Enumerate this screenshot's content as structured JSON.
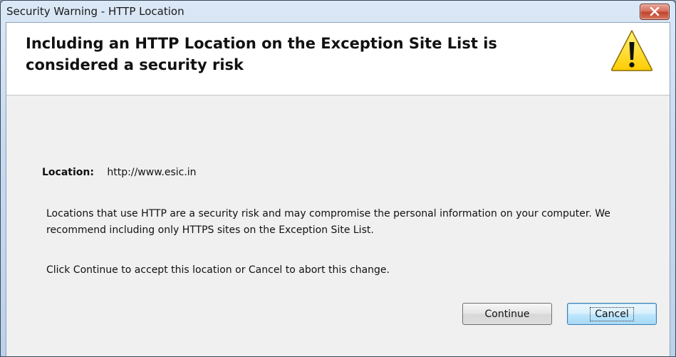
{
  "window": {
    "title": "Security Warning - HTTP Location"
  },
  "header": {
    "headline": "Including an HTTP Location on the Exception Site List is considered a security risk",
    "icon": "warning-icon"
  },
  "location": {
    "label": "Location:",
    "value": "http://www.esic.in"
  },
  "messages": {
    "risk": "Locations that use HTTP are a security risk and may compromise the personal information on your computer.  We recommend including only HTTPS sites on the Exception Site List.",
    "instruction": "Click Continue to accept this location or Cancel to abort this change."
  },
  "buttons": {
    "continue_label": "Continue",
    "cancel_label": "Cancel"
  },
  "colors": {
    "close_button": "#c2432c",
    "warning_fill": "#ffd400",
    "focus_button": "#3c7fb1"
  }
}
